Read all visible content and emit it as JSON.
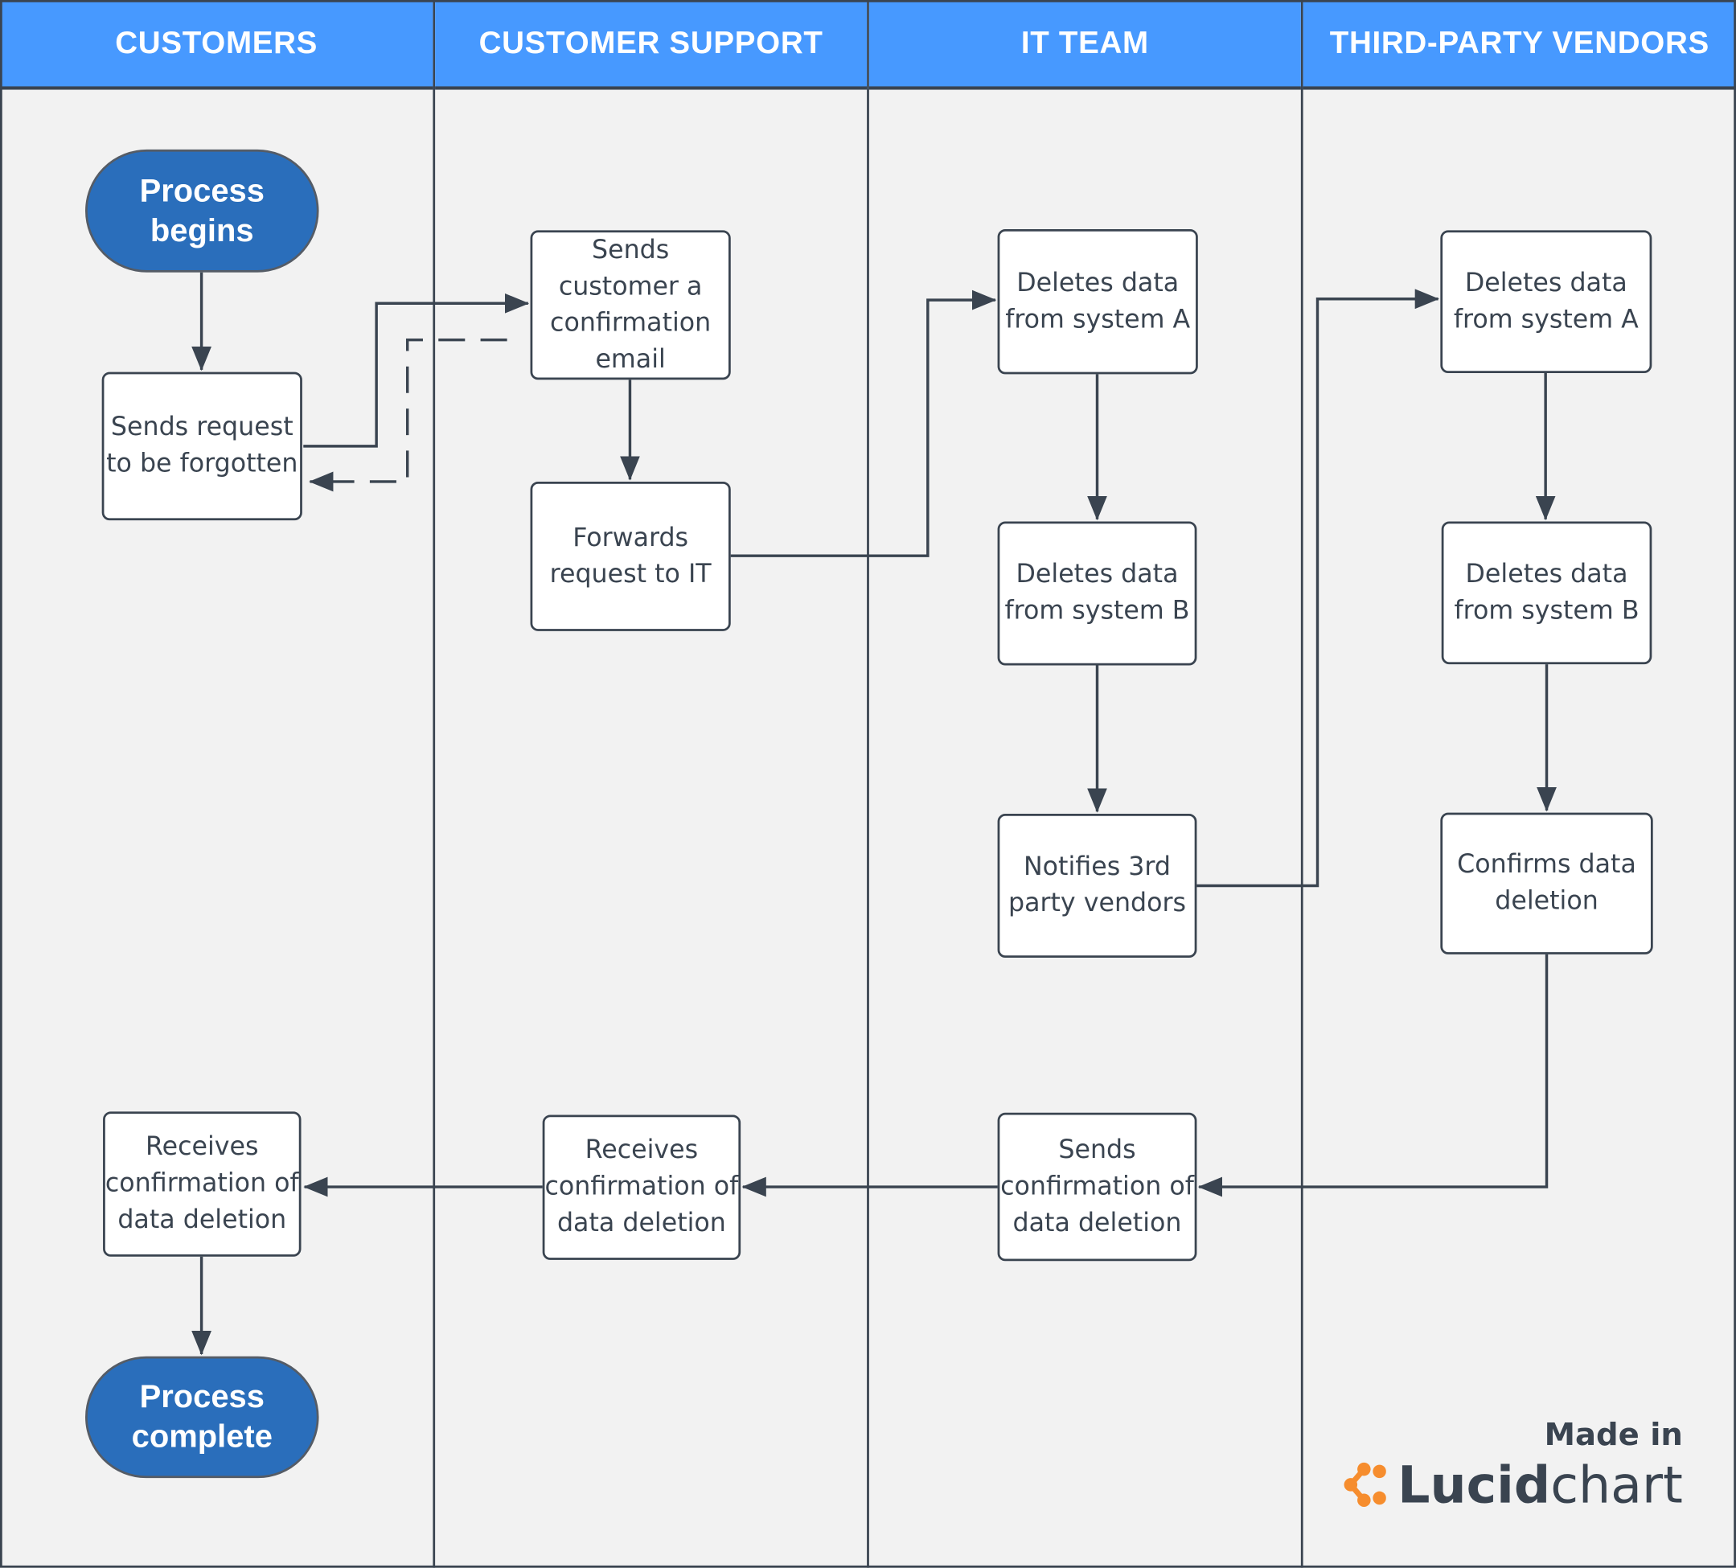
{
  "lanes": [
    {
      "title": "CUSTOMERS"
    },
    {
      "title": "CUSTOMER SUPPORT"
    },
    {
      "title": "IT TEAM"
    },
    {
      "title": "THIRD-PARTY VENDORS"
    }
  ],
  "nodes": {
    "start": "Process\nbegins",
    "request": "Sends request\nto be forgotten",
    "confirm_email": "Sends\ncustomer a\nconfirmation\nemail",
    "forward": "Forwards\nrequest to IT",
    "it_delete_a": "Deletes data\nfrom system A",
    "it_delete_b": "Deletes data\nfrom system B",
    "notify": "Notifies 3rd\nparty vendors",
    "v_delete_a": "Deletes data\nfrom system A",
    "v_delete_b": "Deletes data\nfrom system B",
    "v_confirm": "Confirms data\ndeletion",
    "it_send_conf": "Sends\nconfirmation of\ndata deletion",
    "cs_receive": "Receives\nconfirmation of\ndata deletion",
    "cust_receive": "Receives\nconfirmation of\ndata deletion",
    "end": "Process\ncomplete"
  },
  "logo": {
    "made_in": "Made in",
    "brand_bold": "Lucid",
    "brand_light": "chart",
    "accent_color": "#f68d2e"
  },
  "colors": {
    "header": "#4799ff",
    "terminal": "#2a6ebb",
    "line": "#3a4450"
  }
}
